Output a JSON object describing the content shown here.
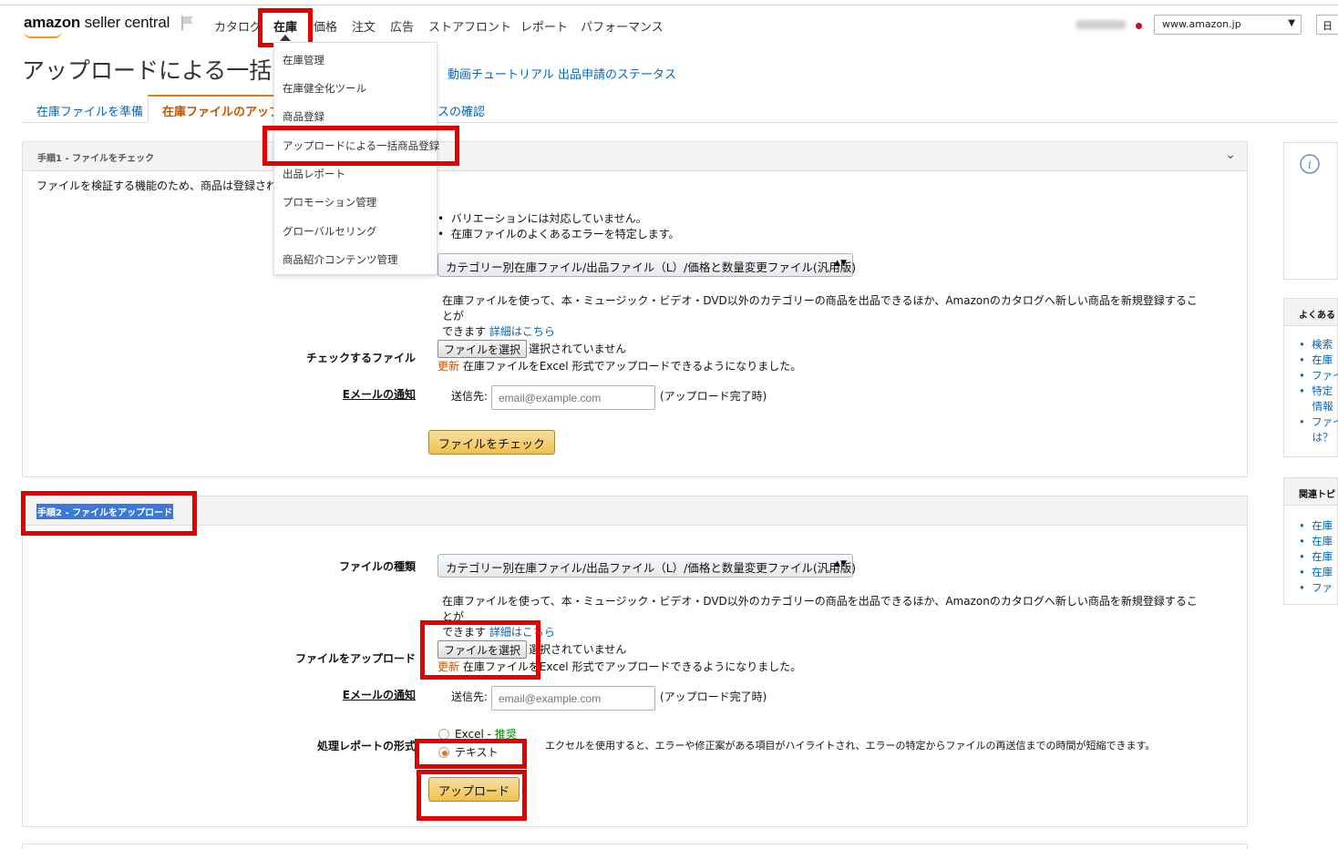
{
  "header": {
    "logo_brand": "amazon",
    "logo_rest": " seller central",
    "nav": [
      "カタログ",
      "在庫",
      "価格",
      "注文",
      "広告",
      "ストアフロント",
      "レポート",
      "パフォーマンス"
    ],
    "marketplace": "www.amazon.jp",
    "right_stub": "日"
  },
  "page": {
    "title": "アップロードによる一括",
    "links": "動画チュートリアル  出品申請のステータス"
  },
  "tabs": [
    "在庫ファイルを準備",
    "在庫ファイルのアップロード",
    "スの確認"
  ],
  "dropdown": {
    "items": [
      "在庫管理",
      "在庫健全化ツール",
      "商品登録",
      "アップロードによる一括商品登録",
      "出品レポート",
      "プロモーション管理",
      "グローバルセリング",
      "商品紹介コンテンツ管理"
    ]
  },
  "step1": {
    "head": "手順1 - ファイルをチェック",
    "intro": "ファイルを検証する機能のため、商品は登録され",
    "bullets": [
      "バリエーションには対応していません。",
      "在庫ファイルのよくあるエラーを特定します。"
    ],
    "file_type": "カテゴリー別在庫ファイル/出品ファイル（L）/価格と数量変更ファイル(汎用版)",
    "desc1": "在庫ファイルを使って、本・ミュージック・ビデオ・DVD以外のカテゴリーの商品を出品できるほか、Amazonのカタログへ新しい商品を新規登録することが",
    "desc2": "できます",
    "desc_link": "詳細はこちら",
    "check_file_label": "チェックするファイル",
    "choose_file": "ファイルを選択",
    "no_file": "選択されていません",
    "update_tag": "更新",
    "update_text": "在庫ファイルをExcel 形式でアップロードできるようになりました。",
    "email_label": "Eメールの通知",
    "send_to": "送信先:",
    "email_placeholder": "email@example.com",
    "email_suffix": "(アップロード完了時)",
    "check_button": "ファイルをチェック"
  },
  "step2": {
    "head": "手順2 - ファイルをアップロード",
    "file_type_label": "ファイルの種類",
    "file_type": "カテゴリー別在庫ファイル/出品ファイル（L）/価格と数量変更ファイル(汎用版)",
    "desc1": "在庫ファイルを使って、本・ミュージック・ビデオ・DVD以外のカテゴリーの商品を出品できるほか、Amazonのカタログへ新しい商品を新規登録することが",
    "desc2": "できます",
    "desc_link": "詳細はこちら",
    "upload_label": "ファイルをアップロード",
    "choose_file": "ファイルを選択",
    "no_file": "選択されていません",
    "update_tag": "更新",
    "update_text": "在庫ファイルをExcel 形式でアップロードできるようになりました。",
    "email_label": "Eメールの通知",
    "send_to": "送信先:",
    "email_placeholder": "email@example.com",
    "email_suffix": "(アップロード完了時)",
    "report_label": "処理レポートの形式",
    "opt_excel": "Excel - ",
    "opt_excel_tag": "推奨",
    "opt_text": "テキスト",
    "report_note": "エクセルを使用すると、エラーや修正案がある項目がハイライトされ、エラーの特定からファイルの再送信までの時間が短縮できます。",
    "upload_button": "アップロード"
  },
  "sidebar": {
    "faq_head": "よくある",
    "faq_items": [
      "検索",
      "在庫",
      "ファイ",
      "特定",
      "情報",
      "ファイ",
      "は？"
    ],
    "topics_head": "関連トピ",
    "topic_items": [
      "在庫",
      "在庫",
      "在庫",
      "在庫",
      "ファ"
    ]
  },
  "colors": {
    "accent": "#e47911",
    "link": "#0066c0",
    "highlight": "#e50000"
  }
}
